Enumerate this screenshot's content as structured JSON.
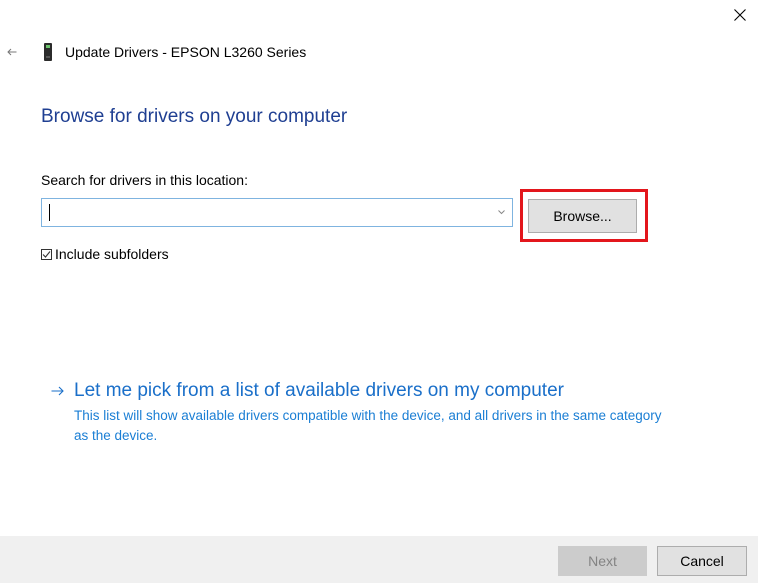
{
  "window": {
    "title": "Update Drivers - EPSON L3260 Series",
    "close_icon": "close-icon",
    "back_icon": "arrow-left-icon",
    "device_icon": "printer-device-icon"
  },
  "page": {
    "heading": "Browse for drivers on your computer"
  },
  "search": {
    "label": "Search for drivers in this location:",
    "value": "",
    "browse_label": "Browse...",
    "highlight_color": "#e3161c"
  },
  "subfolders": {
    "label": "Include subfolders",
    "checked": true
  },
  "pick_list": {
    "link_text": "Let me pick from a list of available drivers on my computer",
    "description": "This list will show available drivers compatible with the device, and all drivers in the same category as the device."
  },
  "footer": {
    "next_label": "Next",
    "next_enabled": false,
    "cancel_label": "Cancel"
  },
  "colors": {
    "heading": "#1f3f92",
    "link": "#1a6fc9",
    "description": "#1a7ed4",
    "footer_bg": "#f0f0f0"
  }
}
